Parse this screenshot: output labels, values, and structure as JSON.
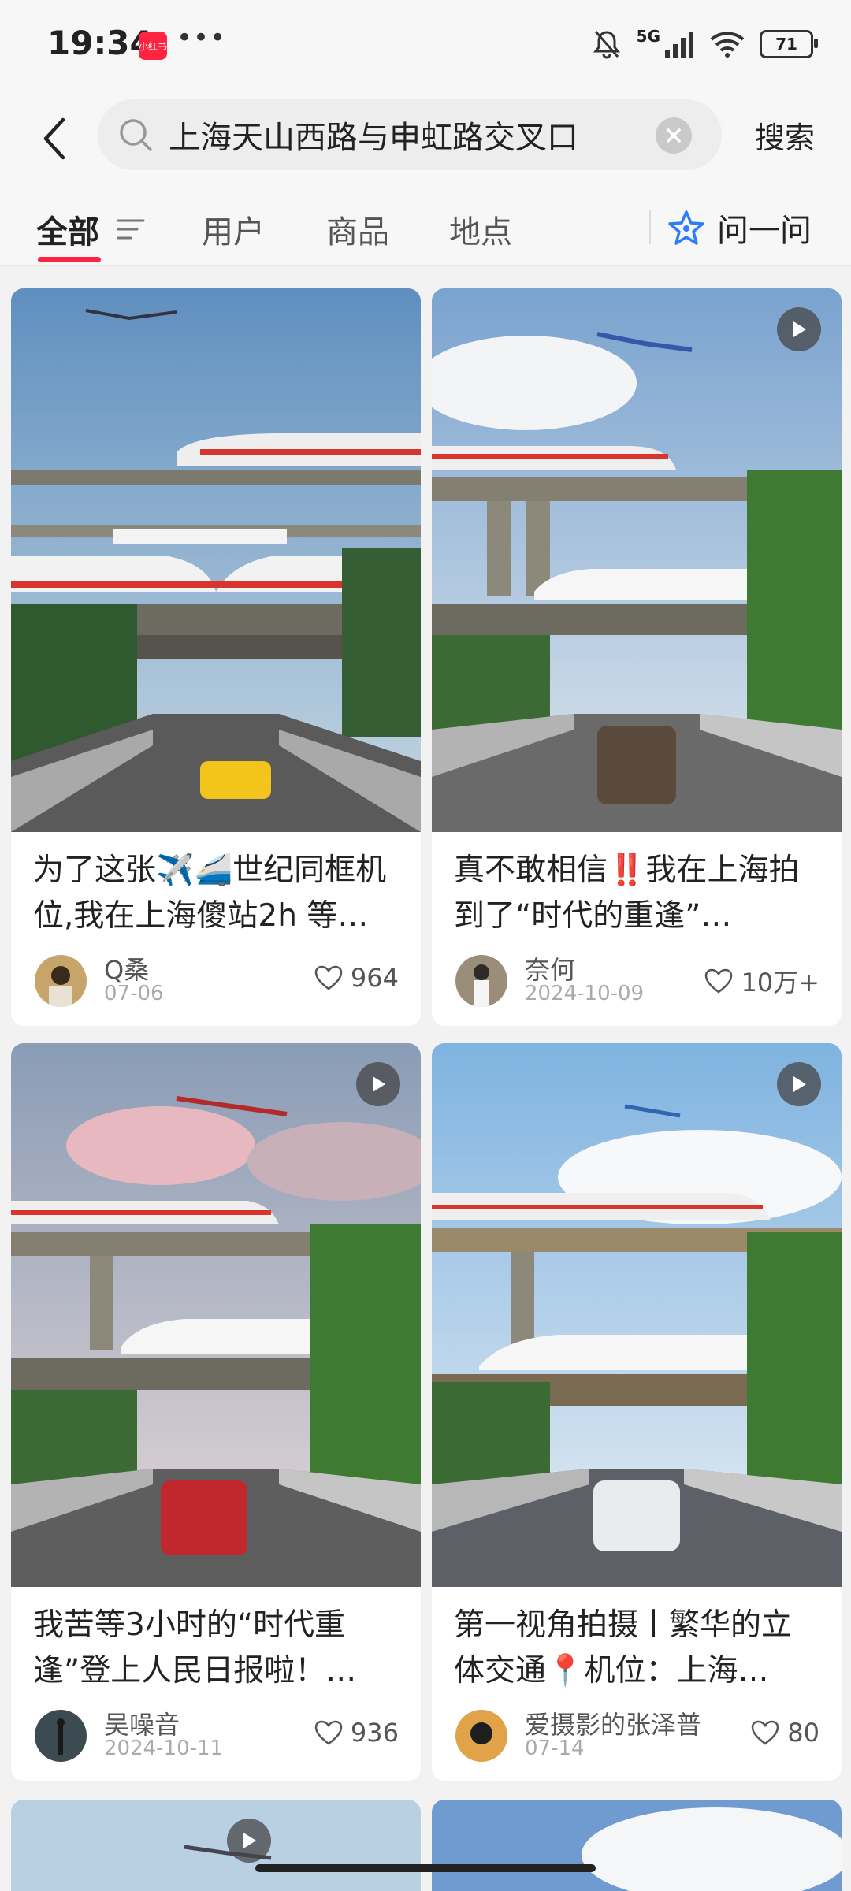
{
  "status_bar": {
    "time": "19:34",
    "app_badge": "小红书",
    "network": "5G",
    "battery": "71"
  },
  "search": {
    "query": "上海天山西路与申虹路交叉口",
    "submit_label": "搜索"
  },
  "tabs": [
    {
      "label": "全部",
      "active": true
    },
    {
      "label": "用户"
    },
    {
      "label": "商品"
    },
    {
      "label": "地点"
    }
  ],
  "ask_label": "问一问",
  "accent_color": "#ff2442",
  "posts": [
    {
      "title": "为了这张✈️🚄世纪同框机位,我在上海傻站2h 等到了…",
      "author": "Q桑",
      "date": "07-06",
      "likes": "964",
      "video": false
    },
    {
      "title": "真不敢相信‼️我在上海拍到了“时代的重逢”…",
      "author": "奈何",
      "date": "2024-10-09",
      "likes": "10万+",
      "video": true
    },
    {
      "title": "我苦等3小时的“时代重逢”登上人民日报啦！…",
      "author": "吴噪音",
      "date": "2024-10-11",
      "likes": "936",
      "video": true
    },
    {
      "title": "第一视角拍摄丨繁华的立体交通📍机位：上海…",
      "author": "爱摄影的张泽普",
      "date": "07-14",
      "likes": "80",
      "video": true
    }
  ]
}
